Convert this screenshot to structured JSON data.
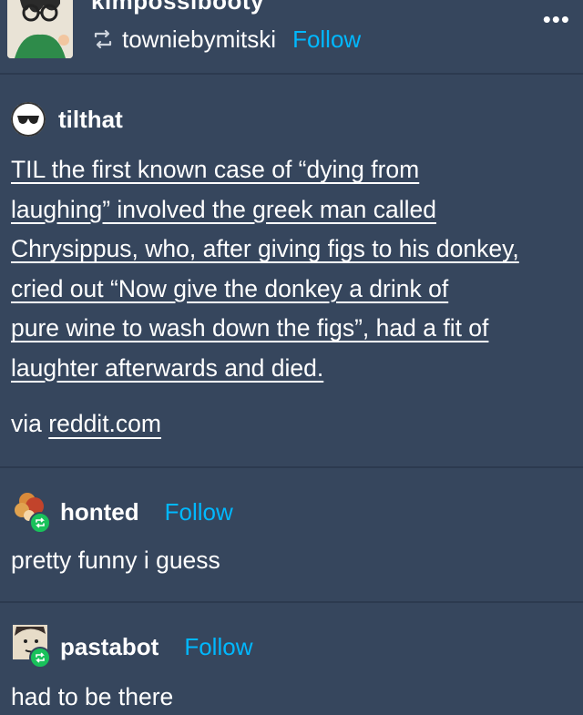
{
  "header": {
    "blog_title": "kimpossibooty",
    "reblogged_from": "towniebymitski",
    "follow_label": "Follow",
    "menu_label": "•••"
  },
  "post": {
    "username": "tilthat",
    "lines": [
      "TIL the first known case of “dying from",
      "laughing” involved the greek man called",
      "Chrysippus, who, after giving figs to his donkey,",
      "cried out “Now give the donkey a drink of",
      "pure wine to wash down the figs”, had a fit of",
      "laughter afterwards and died."
    ],
    "via_prefix": "via",
    "via_link": "reddit.com"
  },
  "replies": [
    {
      "username": "honted",
      "follow_label": "Follow",
      "text": "pretty funny i guess"
    },
    {
      "username": "pastabot",
      "follow_label": "Follow",
      "text": "had to be there"
    }
  ],
  "colors": {
    "background": "#36465d",
    "accent": "#00b8ff",
    "reblog_badge": "#19c15b"
  }
}
